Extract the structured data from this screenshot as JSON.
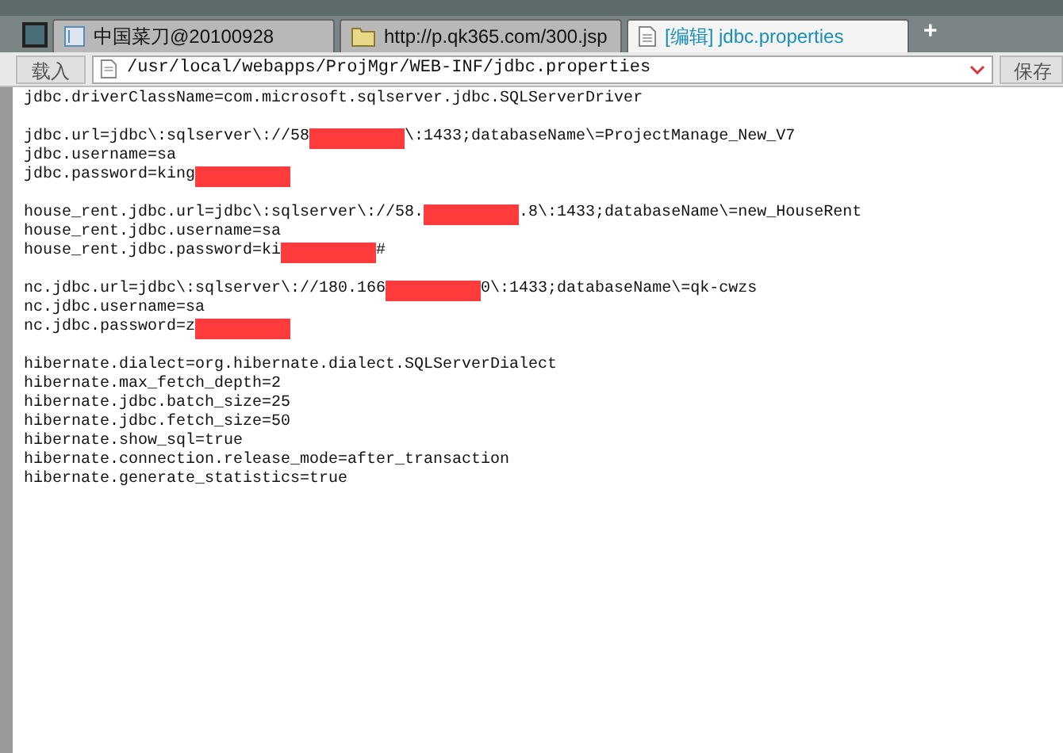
{
  "tabs": [
    {
      "kind": "page",
      "label": "中国菜刀@20100928",
      "selected": false
    },
    {
      "kind": "folder",
      "label": "http://p.qk365.com/300.jsp",
      "selected": false
    },
    {
      "kind": "file",
      "label": "[编辑] jdbc.properties",
      "selected": true
    }
  ],
  "new_tab": "+",
  "toolbar": {
    "load_button": "载入",
    "path": "/usr/local/webapps/ProjMgr/WEB-INF/jdbc.properties",
    "save_button": "保存"
  },
  "blocks": [
    {
      "lines": [
        [
          {
            "kind": "text",
            "text": "jdbc.driverClassName=com.microsoft.sqlserver.jdbc.SQLServerDriver"
          }
        ]
      ]
    },
    {
      "lines": [
        [
          {
            "kind": "text",
            "text": "jdbc.url=jdbc\\:sqlserver\\://58"
          },
          {
            "kind": "redaction"
          },
          {
            "kind": "text",
            "text": "\\:1433;databaseName\\=ProjectManage_New_V7"
          }
        ],
        [
          {
            "kind": "text",
            "text": "jdbc.username=sa"
          }
        ],
        [
          {
            "kind": "text",
            "text": "jdbc.password=king"
          },
          {
            "kind": "redaction"
          }
        ]
      ]
    },
    {
      "lines": [
        [
          {
            "kind": "text",
            "text": "house_rent.jdbc.url=jdbc\\:sqlserver\\://58."
          },
          {
            "kind": "redaction"
          },
          {
            "kind": "text",
            "text": ".8\\:1433;databaseName\\=new_HouseRent"
          }
        ],
        [
          {
            "kind": "text",
            "text": "house_rent.jdbc.username=sa"
          }
        ],
        [
          {
            "kind": "text",
            "text": "house_rent.jdbc.password=ki"
          },
          {
            "kind": "redaction"
          },
          {
            "kind": "text",
            "text": "#"
          }
        ]
      ]
    },
    {
      "lines": [
        [
          {
            "kind": "text",
            "text": "nc.jdbc.url=jdbc\\:sqlserver\\://180.166"
          },
          {
            "kind": "redaction"
          },
          {
            "kind": "text",
            "text": "0\\:1433;databaseName\\=qk-cwzs"
          }
        ],
        [
          {
            "kind": "text",
            "text": "nc.jdbc.username=sa"
          }
        ],
        [
          {
            "kind": "text",
            "text": "nc.jdbc.password=z"
          },
          {
            "kind": "redaction"
          }
        ]
      ]
    },
    {
      "lines": [
        [
          {
            "kind": "text",
            "text": "hibernate.dialect=org.hibernate.dialect.SQLServerDialect"
          }
        ],
        [
          {
            "kind": "text",
            "text": "hibernate.max_fetch_depth=2"
          }
        ],
        [
          {
            "kind": "text",
            "text": "hibernate.jdbc.batch_size=25"
          }
        ],
        [
          {
            "kind": "text",
            "text": "hibernate.jdbc.fetch_size=50"
          }
        ],
        [
          {
            "kind": "text",
            "text": "hibernate.show_sql=true"
          }
        ],
        [
          {
            "kind": "text",
            "text": "hibernate.connection.release_mode=after_transaction"
          }
        ],
        [
          {
            "kind": "text",
            "text": "hibernate.generate_statistics=true"
          }
        ]
      ]
    }
  ]
}
